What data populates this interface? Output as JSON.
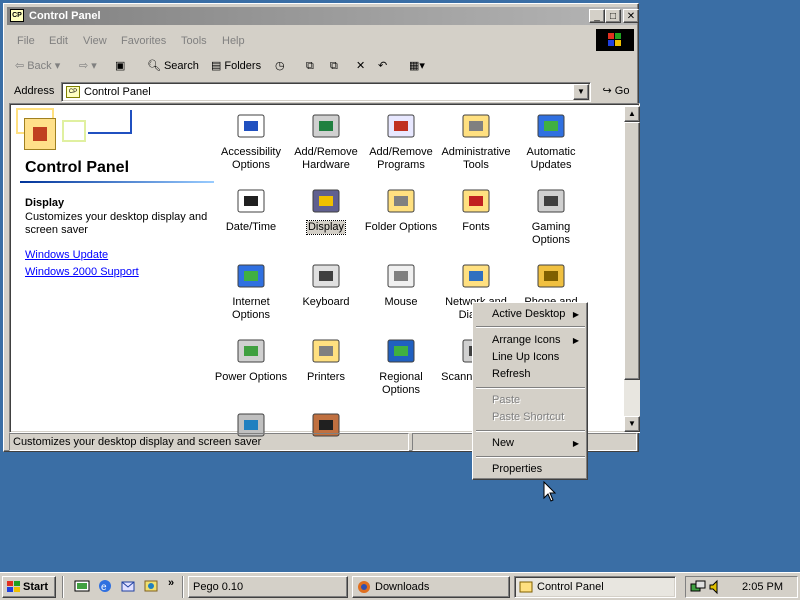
{
  "window": {
    "title": "Control Panel",
    "controls": {
      "minimize": "_",
      "maximize": "□",
      "close": "✕"
    }
  },
  "menubar": [
    "File",
    "Edit",
    "View",
    "Favorites",
    "Tools",
    "Help"
  ],
  "toolbar": {
    "back": "Back",
    "search": "Search",
    "folders": "Folders"
  },
  "address": {
    "label": "Address",
    "value": "Control Panel",
    "go": "Go"
  },
  "leftpane": {
    "title": "Control Panel",
    "selected_name": "Display",
    "selected_desc": "Customizes your desktop display and screen saver",
    "links": [
      "Windows Update",
      "Windows 2000 Support"
    ]
  },
  "icons": [
    {
      "label": "Accessibility Options",
      "icon": "accessibility-icon"
    },
    {
      "label": "Add/Remove Hardware",
      "icon": "add-hardware-icon"
    },
    {
      "label": "Add/Remove Programs",
      "icon": "add-programs-icon"
    },
    {
      "label": "Administrative Tools",
      "icon": "admin-tools-icon"
    },
    {
      "label": "Automatic Updates",
      "icon": "windows-update-icon"
    },
    {
      "label": "Date/Time",
      "icon": "calendar-clock-icon"
    },
    {
      "label": "Display",
      "icon": "display-icon"
    },
    {
      "label": "Folder Options",
      "icon": "folder-options-icon"
    },
    {
      "label": "Fonts",
      "icon": "fonts-folder-icon"
    },
    {
      "label": "Gaming Options",
      "icon": "joystick-icon"
    },
    {
      "label": "Internet Options",
      "icon": "globe-icon"
    },
    {
      "label": "Keyboard",
      "icon": "keyboard-icon"
    },
    {
      "label": "Mouse",
      "icon": "mouse-icon"
    },
    {
      "label": "Network and Dial-up",
      "icon": "network-folder-icon"
    },
    {
      "label": "Phone and",
      "icon": "phone-icon"
    },
    {
      "label": "Power Options",
      "icon": "power-plug-icon"
    },
    {
      "label": "Printers",
      "icon": "printer-folder-icon"
    },
    {
      "label": "Regional Options",
      "icon": "regional-globe-icon"
    },
    {
      "label": "Scanne Came",
      "icon": "scanner-icon"
    },
    {
      "label": "",
      "icon": "speaker-icon"
    },
    {
      "label": "",
      "icon": "monitor-icon"
    },
    {
      "label": "",
      "icon": "users-icon"
    }
  ],
  "status": {
    "text": "Customizes your desktop display and screen saver"
  },
  "context_menu": {
    "items": [
      {
        "label": "Active Desktop",
        "submenu": true,
        "disabled": false
      },
      {
        "label": "Arrange Icons",
        "submenu": true,
        "disabled": false
      },
      {
        "label": "Line Up Icons",
        "submenu": false,
        "disabled": false
      },
      {
        "label": "Refresh",
        "submenu": false,
        "disabled": false
      },
      {
        "label": "Paste",
        "submenu": false,
        "disabled": true
      },
      {
        "label": "Paste Shortcut",
        "submenu": false,
        "disabled": true
      },
      {
        "label": "New",
        "submenu": true,
        "disabled": false
      },
      {
        "label": "Properties",
        "submenu": false,
        "disabled": false
      }
    ]
  },
  "taskbar": {
    "start": "Start",
    "tasks": [
      "Pego 0.10",
      "Downloads",
      "Control Panel"
    ],
    "clock": "2:05 PM"
  },
  "colors": {
    "desktop": "#3a6ea5",
    "chrome": "#d4d0c8",
    "link": "#0000ff"
  }
}
